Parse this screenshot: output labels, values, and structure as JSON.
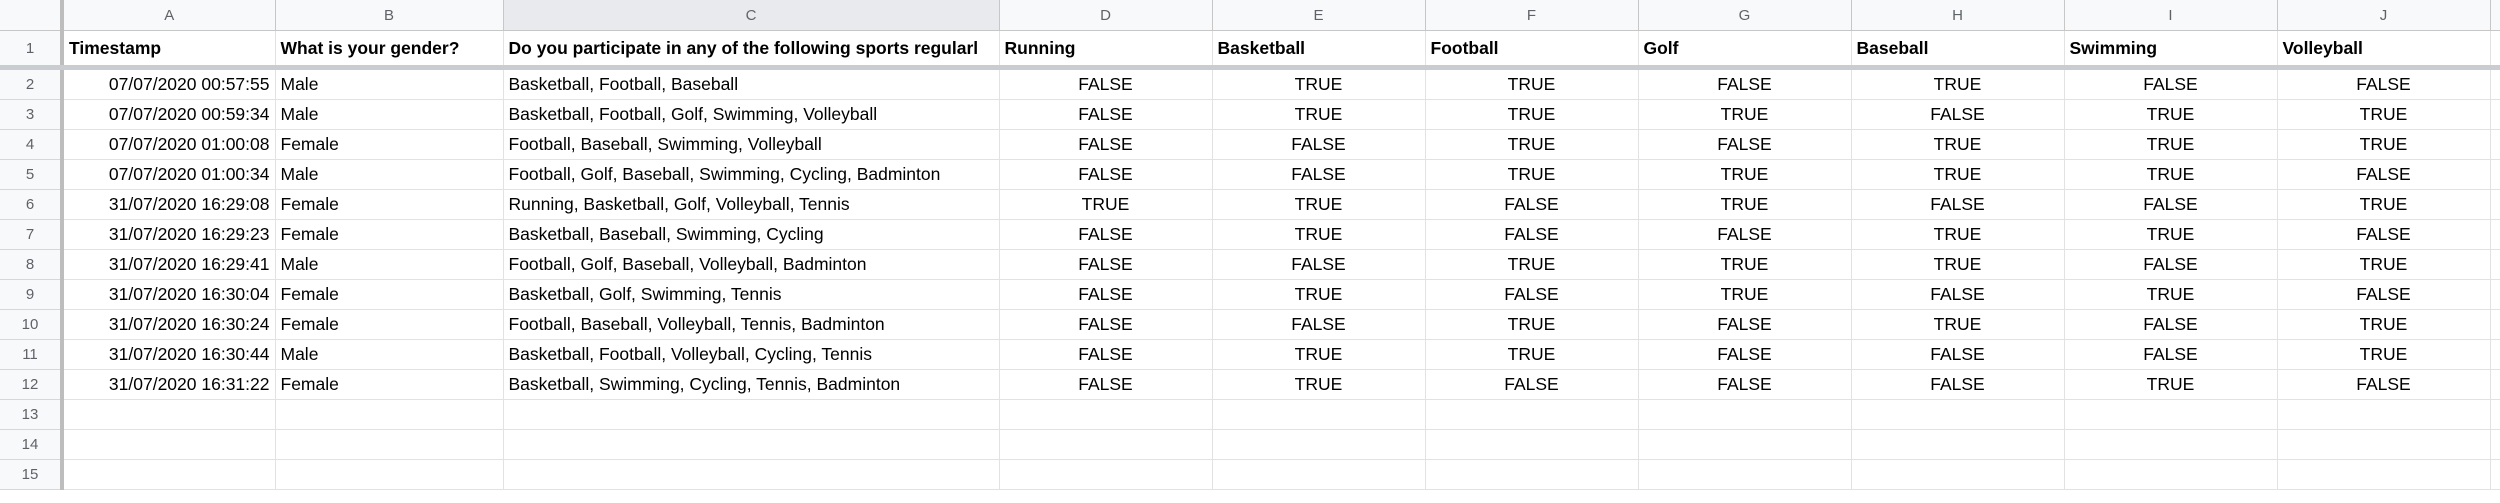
{
  "columns": [
    "A",
    "B",
    "C",
    "D",
    "E",
    "F",
    "G",
    "H",
    "I",
    "J",
    ""
  ],
  "header_row": {
    "number": "1",
    "cells": [
      "Timestamp",
      "What is your gender?",
      "Do you participate in any of the following sports regularl",
      "Running",
      "Basketball",
      "Football",
      "Golf",
      "Baseball",
      "Swimming",
      "Volleyball",
      ""
    ]
  },
  "rows": [
    {
      "number": "2",
      "cells": [
        "07/07/2020 00:57:55",
        "Male",
        "Basketball, Football, Baseball",
        "FALSE",
        "TRUE",
        "TRUE",
        "FALSE",
        "TRUE",
        "FALSE",
        "FALSE",
        ""
      ]
    },
    {
      "number": "3",
      "cells": [
        "07/07/2020 00:59:34",
        "Male",
        "Basketball, Football, Golf, Swimming, Volleyball",
        "FALSE",
        "TRUE",
        "TRUE",
        "TRUE",
        "FALSE",
        "TRUE",
        "TRUE",
        ""
      ]
    },
    {
      "number": "4",
      "cells": [
        "07/07/2020 01:00:08",
        "Female",
        "Football, Baseball, Swimming, Volleyball",
        "FALSE",
        "FALSE",
        "TRUE",
        "FALSE",
        "TRUE",
        "TRUE",
        "TRUE",
        ""
      ]
    },
    {
      "number": "5",
      "cells": [
        "07/07/2020 01:00:34",
        "Male",
        "Football, Golf, Baseball, Swimming, Cycling, Badminton",
        "FALSE",
        "FALSE",
        "TRUE",
        "TRUE",
        "TRUE",
        "TRUE",
        "FALSE",
        ""
      ]
    },
    {
      "number": "6",
      "cells": [
        "31/07/2020 16:29:08",
        "Female",
        "Running, Basketball, Golf, Volleyball, Tennis",
        "TRUE",
        "TRUE",
        "FALSE",
        "TRUE",
        "FALSE",
        "FALSE",
        "TRUE",
        ""
      ]
    },
    {
      "number": "7",
      "cells": [
        "31/07/2020 16:29:23",
        "Female",
        "Basketball, Baseball, Swimming, Cycling",
        "FALSE",
        "TRUE",
        "FALSE",
        "FALSE",
        "TRUE",
        "TRUE",
        "FALSE",
        ""
      ]
    },
    {
      "number": "8",
      "cells": [
        "31/07/2020 16:29:41",
        "Male",
        "Football, Golf, Baseball, Volleyball, Badminton",
        "FALSE",
        "FALSE",
        "TRUE",
        "TRUE",
        "TRUE",
        "FALSE",
        "TRUE",
        ""
      ]
    },
    {
      "number": "9",
      "cells": [
        "31/07/2020 16:30:04",
        "Female",
        "Basketball, Golf, Swimming, Tennis",
        "FALSE",
        "TRUE",
        "FALSE",
        "TRUE",
        "FALSE",
        "TRUE",
        "FALSE",
        ""
      ]
    },
    {
      "number": "10",
      "cells": [
        "31/07/2020 16:30:24",
        "Female",
        "Football, Baseball, Volleyball, Tennis, Badminton",
        "FALSE",
        "FALSE",
        "TRUE",
        "FALSE",
        "TRUE",
        "FALSE",
        "TRUE",
        ""
      ]
    },
    {
      "number": "11",
      "cells": [
        "31/07/2020 16:30:44",
        "Male",
        "Basketball, Football, Volleyball, Cycling, Tennis",
        "FALSE",
        "TRUE",
        "TRUE",
        "FALSE",
        "FALSE",
        "FALSE",
        "TRUE",
        ""
      ]
    },
    {
      "number": "12",
      "cells": [
        "31/07/2020 16:31:22",
        "Female",
        "Basketball, Swimming, Cycling, Tennis, Badminton",
        "FALSE",
        "TRUE",
        "FALSE",
        "FALSE",
        "FALSE",
        "TRUE",
        "FALSE",
        ""
      ]
    },
    {
      "number": "13",
      "cells": [
        "",
        "",
        "",
        "",
        "",
        "",
        "",
        "",
        "",
        "",
        ""
      ]
    },
    {
      "number": "14",
      "cells": [
        "",
        "",
        "",
        "",
        "",
        "",
        "",
        "",
        "",
        "",
        ""
      ]
    },
    {
      "number": "15",
      "cells": [
        "",
        "",
        "",
        "",
        "",
        "",
        "",
        "",
        "",
        "",
        ""
      ]
    }
  ]
}
